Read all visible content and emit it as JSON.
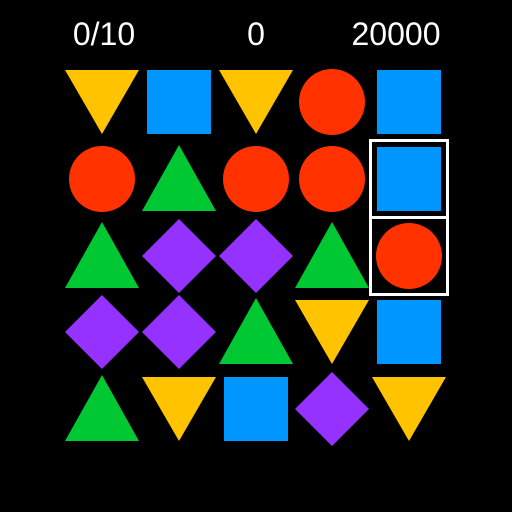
{
  "hud": {
    "moves": "0/10",
    "score": "0",
    "target": "20000"
  },
  "colors": {
    "background": "#000000",
    "text": "#ffffff",
    "yellow": "#ffc300",
    "blue": "#0096ff",
    "red": "#ff3200",
    "green": "#00c832",
    "purple": "#9632ff",
    "selection": "#ffffff"
  },
  "board": {
    "rows": 5,
    "cols": 5,
    "pieces": [
      [
        "yellow-down-triangle",
        "blue-square",
        "yellow-down-triangle",
        "red-circle",
        "blue-square"
      ],
      [
        "red-circle",
        "green-up-triangle",
        "red-circle",
        "red-circle",
        "blue-square"
      ],
      [
        "green-up-triangle",
        "purple-diamond",
        "purple-diamond",
        "green-up-triangle",
        "red-circle"
      ],
      [
        "purple-diamond",
        "purple-diamond",
        "green-up-triangle",
        "yellow-down-triangle",
        "blue-square"
      ],
      [
        "green-up-triangle",
        "yellow-down-triangle",
        "blue-square",
        "purple-diamond",
        "yellow-down-triangle"
      ]
    ],
    "selected": [
      [
        1,
        4
      ],
      [
        2,
        4
      ]
    ]
  }
}
